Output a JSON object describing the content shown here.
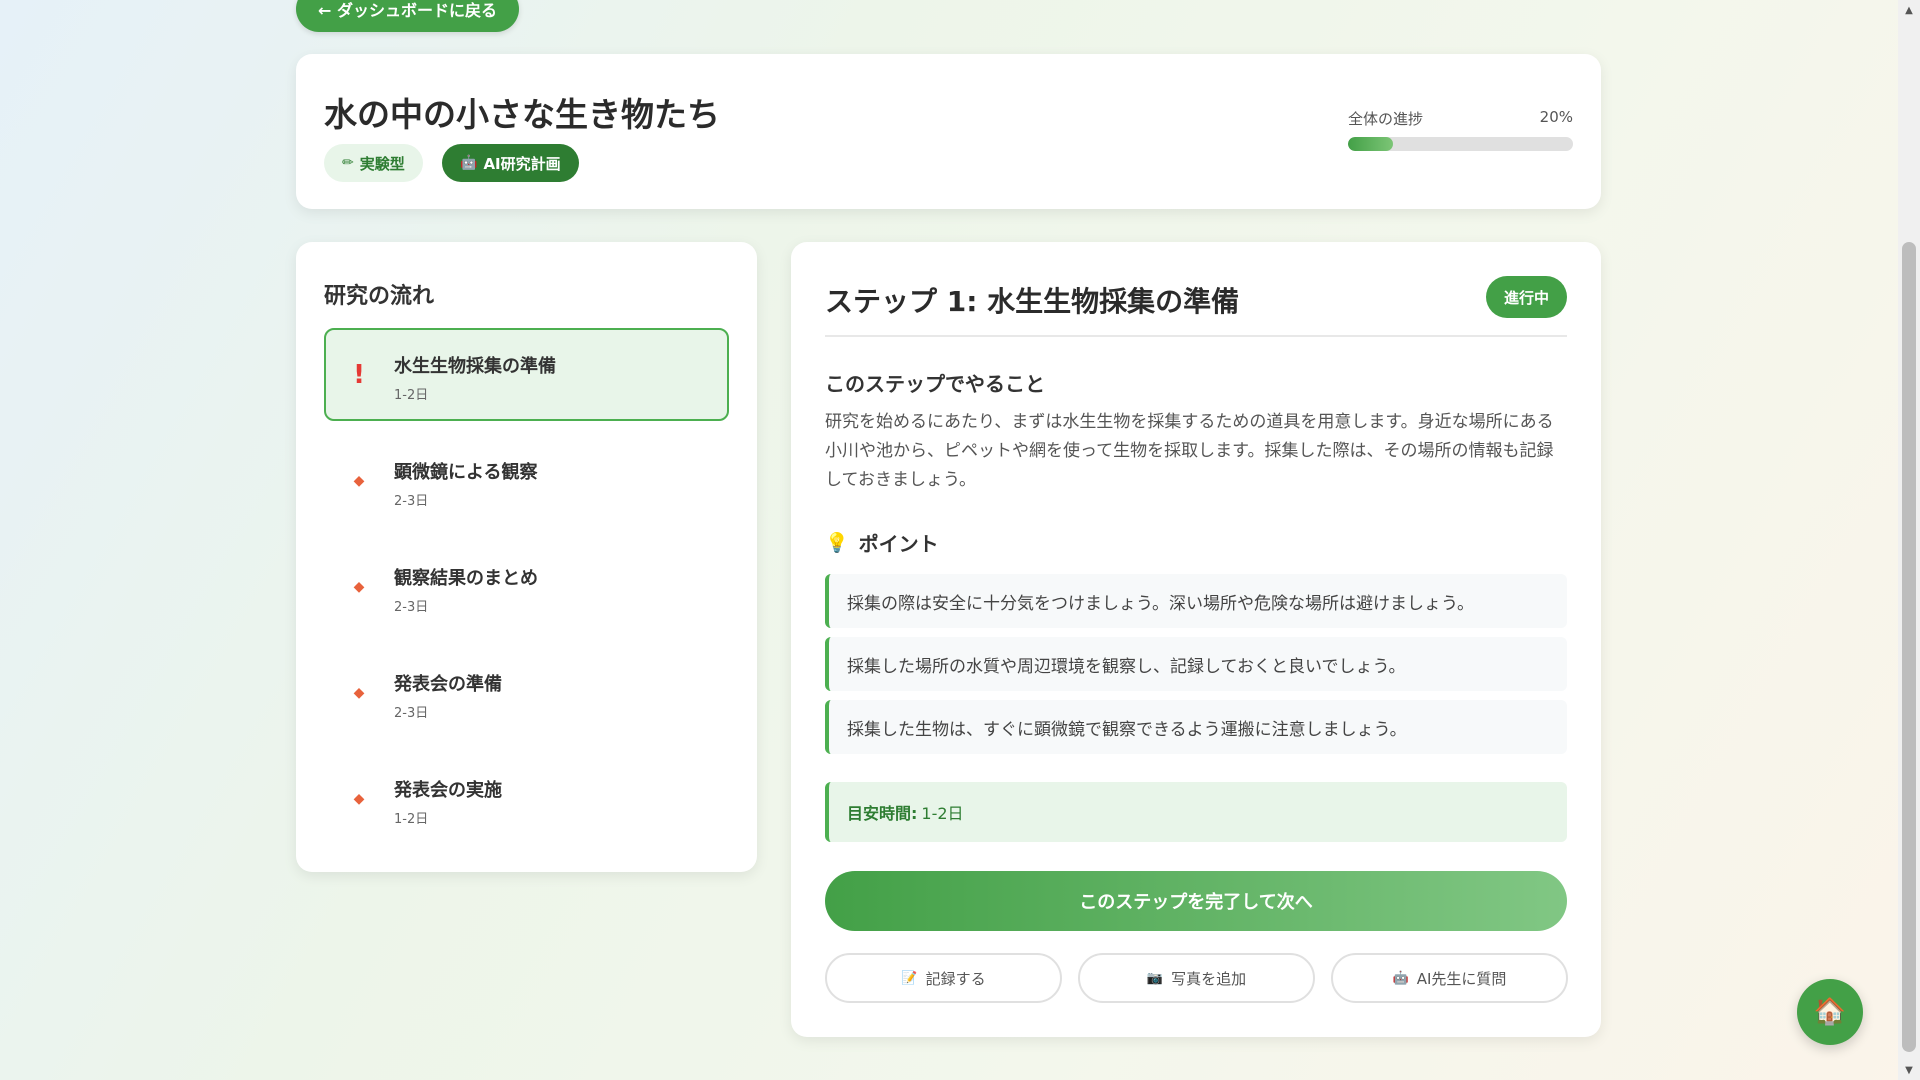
{
  "nav": {
    "back_label": "← ダッシュボードに戻る"
  },
  "header": {
    "title": "水の中の小さな生き物たち",
    "tags": [
      {
        "icon": "✏",
        "label": "実験型"
      },
      {
        "icon": "🤖",
        "label": "AI研究計画"
      }
    ],
    "progress": {
      "label": "全体の進捗",
      "percent_label": "20%",
      "value": 0.2
    }
  },
  "flow": {
    "title": "研究の流れ",
    "items": [
      {
        "name": "水生生物採集の準備",
        "days": "1-2日",
        "marker": "!",
        "active": true
      },
      {
        "name": "顕微鏡による観察",
        "days": "2-3日",
        "marker": "◆",
        "active": false
      },
      {
        "name": "観察結果のまとめ",
        "days": "2-3日",
        "marker": "◆",
        "active": false
      },
      {
        "name": "発表会の準備",
        "days": "2-3日",
        "marker": "◆",
        "active": false
      },
      {
        "name": "発表会の実施",
        "days": "1-2日",
        "marker": "◆",
        "active": false
      }
    ]
  },
  "step": {
    "title": "ステップ 1: 水生生物採集の準備",
    "status": "進行中",
    "section_heading": "このステップでやること",
    "description": "研究を始めるにあたり、まずは水生生物を採集するための道具を用意します。身近な場所にある小川や池から、ピペットや網を使って生物を採取します。採集した際は、その場所の情報も記録しておきましょう。",
    "points_icon": "💡",
    "points_heading": "ポイント",
    "tips": [
      "採集の際は安全に十分気をつけましょう。深い場所や危険な場所は避けましょう。",
      "採集した場所の水質や周辺環境を観察し、記録しておくと良いでしょう。",
      "採集した生物は、すぐに顕微鏡で観察できるよう運搬に注意しましょう。"
    ],
    "time_label": "目安時間:",
    "time_value": "1-2日",
    "complete_label": "このステップを完了して次へ",
    "actions": [
      {
        "icon": "📝",
        "label": "記録する"
      },
      {
        "icon": "📷",
        "label": "写真を追加"
      },
      {
        "icon": "🤖",
        "label": "AI先生に質問"
      }
    ]
  },
  "fab": {
    "icon": "🏠"
  },
  "colors": {
    "primary": "#43a047",
    "primary_dark": "#2e7d32",
    "light": "#e8f5e9",
    "warning": "#e53935",
    "diamond": "#e8623c"
  }
}
